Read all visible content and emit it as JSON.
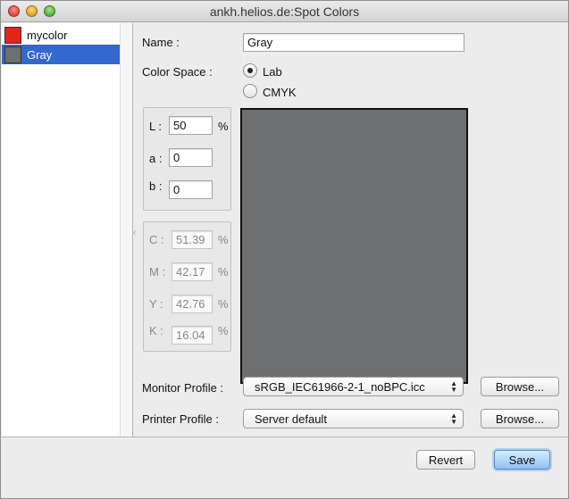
{
  "window": {
    "title": "ankh.helios.de:Spot Colors"
  },
  "colors_list": [
    {
      "name": "mycolor",
      "swatch": "#e1251b",
      "selected": false
    },
    {
      "name": "Gray",
      "swatch": "#6e6f70",
      "selected": true
    }
  ],
  "form": {
    "name_label": "Name :",
    "name_value": "Gray",
    "color_space_label": "Color Space :",
    "color_space_options": [
      "Lab",
      "CMYK"
    ],
    "color_space_selected": "Lab",
    "lab": {
      "l_label": "L :",
      "l_value": "50",
      "l_unit": "%",
      "a_label": "a :",
      "a_value": "0",
      "b_label": "b :",
      "b_value": "0"
    },
    "cmyk": {
      "c_label": "C :",
      "c_value": "51.39",
      "m_label": "M :",
      "m_value": "42.17",
      "y_label": "Y :",
      "y_value": "42.76",
      "k_label": "K :",
      "k_value": "16.04",
      "unit": "%"
    },
    "preview_color": "#6e6f70",
    "monitor_profile_label": "Monitor Profile :",
    "monitor_profile_value": "sRGB_IEC61966-2-1_noBPC.icc",
    "printer_profile_label": "Printer Profile :",
    "printer_profile_value": "Server default",
    "browse_label": "Browse..."
  },
  "footer": {
    "revert_label": "Revert",
    "save_label": "Save"
  }
}
